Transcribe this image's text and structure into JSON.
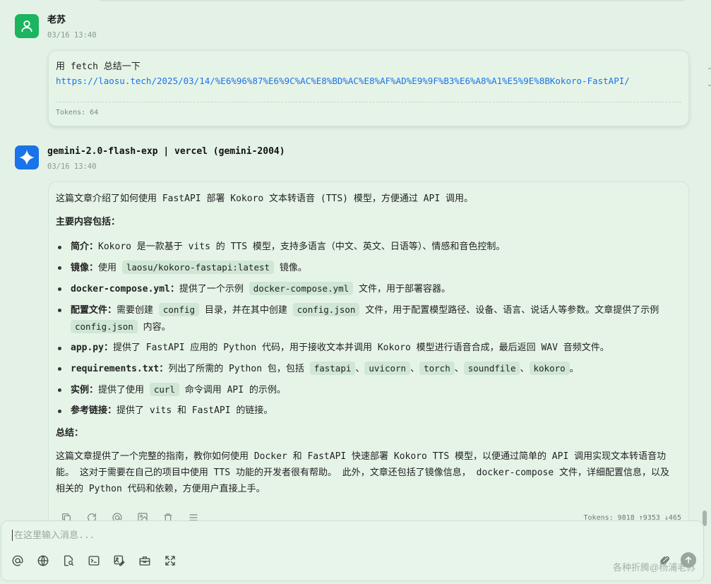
{
  "user_message": {
    "sender": "老苏",
    "time": "03/16 13:40",
    "text": "用 fetch 总结一下",
    "link": "https://laosu.tech/2025/03/14/%E6%96%87%E6%9C%AC%E8%BD%AC%E8%AF%AD%E9%9F%B3%E6%A8%A1%E5%9E%8BKokoro-FastAPI/",
    "tokens": "Tokens: 64"
  },
  "bot_message": {
    "sender": "gemini-2.0-flash-exp | vercel (gemini-2004)",
    "time": "03/16 13:40",
    "intro": "这篇文章介绍了如何使用 FastAPI 部署 Kokoro 文本转语音 (TTS) 模型，方便通过 API 调用。",
    "main_heading": "主要内容包括：",
    "items": {
      "intro": {
        "label": "简介：",
        "text": "Kokoro 是一款基于 vits 的 TTS 模型，支持多语言（中文、英文、日语等）、情感和音色控制。"
      },
      "image": {
        "label": "镜像：",
        "pre": "使用 ",
        "code": "laosu/kokoro-fastapi:latest",
        "post": " 镜像。"
      },
      "compose": {
        "label": "docker-compose.yml：",
        "pre": "提供了一个示例 ",
        "code": "docker-compose.yml",
        "post": " 文件，用于部署容器。"
      },
      "config": {
        "label": "配置文件：",
        "pre": "需要创建 ",
        "code1": "config",
        "mid": " 目录，并在其中创建 ",
        "code2": "config.json",
        "mid2": " 文件，用于配置模型路径、设备、语言、说话人等参数。文章提供了示例 ",
        "code3": "config.json",
        "post": " 内容。"
      },
      "app": {
        "label": "app.py：",
        "text": "提供了 FastAPI 应用的 Python 代码，用于接收文本并调用 Kokoro 模型进行语音合成，最后返回 WAV 音频文件。"
      },
      "reqs": {
        "label": "requirements.txt：",
        "pre": "列出了所需的 Python 包，包括 ",
        "codes": [
          "fastapi",
          "uvicorn",
          "torch",
          "soundfile",
          "kokoro"
        ],
        "sep": "、",
        "post": "。"
      },
      "example": {
        "label": "实例：",
        "pre": "提供了使用 ",
        "code": "curl",
        "post": " 命令调用 API 的示例。"
      },
      "refs": {
        "label": "参考链接：",
        "text": "提供了 vits 和 FastAPI 的链接。"
      }
    },
    "summary_heading": "总结：",
    "summary": "这篇文章提供了一个完整的指南，教你如何使用 Docker 和 FastAPI 快速部署 Kokoro TTS 模型，以便通过简单的 API 调用实现文本转语音功能。 这对于需要在自己的项目中使用 TTS 功能的开发者很有帮助。 此外，文章还包括了镜像信息， docker-compose 文件，详细配置信息，以及相关的 Python 代码和依赖，方便用户直接上手。",
    "tokens": "Tokens: 9818 ↑9353 ↓465"
  },
  "composer": {
    "placeholder": "在这里输入消息..."
  },
  "watermark": "各种折腾@杨浦老苏",
  "colors": {
    "user_avatar": "#1bb45f",
    "bot_avatar": "#1a73e8",
    "link": "#1a73e8",
    "background": "#e3f1e6"
  },
  "icons": {
    "message_actions": [
      "copy-icon",
      "regenerate-icon",
      "mention-icon",
      "image-icon",
      "delete-icon",
      "menu-icon"
    ],
    "toolbar": [
      "at-icon",
      "globe-icon",
      "document-search-icon",
      "terminal-icon",
      "image-edit-icon",
      "toolbox-icon",
      "expand-icon"
    ],
    "send": [
      "attach-icon",
      "send-icon"
    ]
  }
}
